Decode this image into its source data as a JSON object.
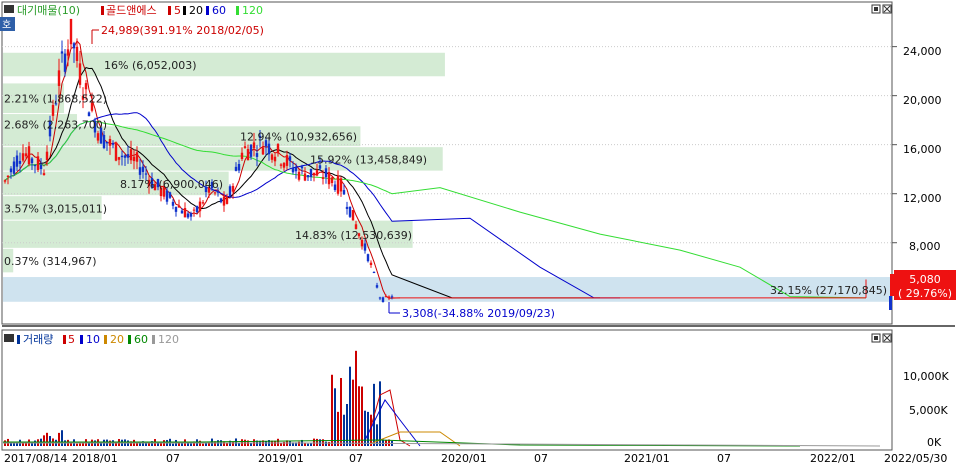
{
  "price_panel": {
    "legend": [
      "대기매물(10)",
      "골드앤에스",
      "5",
      "20",
      "60",
      "120"
    ],
    "legend_colors": [
      "#2a9d2a",
      "#cc0000",
      "#cc0000",
      "#000000",
      "#0000cc",
      "#33dd33"
    ],
    "y_ticks": [
      "24,000",
      "20,000",
      "16,000",
      "12,000",
      "8,000"
    ],
    "high_label": "24,989(391.91% 2018/02/05)",
    "low_label": "3,308(-34.88% 2019/09/23)",
    "current_price": "5,080",
    "current_change": "( 29.76%)",
    "left_tab": "호"
  },
  "volume_panel": {
    "legend": [
      "거래량",
      "5",
      "10",
      "20",
      "60",
      "120"
    ],
    "legend_colors": [
      "#003399",
      "#cc0000",
      "#0000cc",
      "#cc8800",
      "#008800",
      "#999999"
    ],
    "y_ticks": [
      "10,000K",
      "5,000K",
      "0K"
    ]
  },
  "x_axis": {
    "labels": [
      "2017/08/14",
      "2018/01",
      "07",
      "2019/01",
      "07",
      "2020/01",
      "07",
      "2021/01",
      "07",
      "2022/01",
      "2022/05/30"
    ]
  },
  "chart_data": {
    "type": "candlestick",
    "title": "골드앤에스",
    "x_range": [
      "2017/08/14",
      "2022/05/30"
    ],
    "ylim": [
      3000,
      26500
    ],
    "volume_ylim": [
      0,
      14500
    ],
    "volume_unit": "K",
    "high": {
      "date": "2018/02/05",
      "value": 24989,
      "change_pct": 391.91
    },
    "low": {
      "date": "2019/09/23",
      "value": 3308,
      "change_pct": -34.88
    },
    "last": {
      "date": "2022/05/30",
      "value": 5080,
      "change_pct": 29.76
    },
    "overhang_volume_profile": [
      {
        "label": "16% (6,052,003)",
        "percent": 16
      },
      {
        "label": "2.21% (1,868,522)",
        "percent": 2.21
      },
      {
        "label": "2.68% (2,263,700)",
        "percent": 2.68
      },
      {
        "label": "12.94% (10,932,656)",
        "percent": 12.94
      },
      {
        "label": "15.92% (13,458,849)",
        "percent": 15.92
      },
      {
        "label": "8.17% (6,900,046)",
        "percent": 8.17
      },
      {
        "label": "3.57% (3,015,011)",
        "percent": 3.57
      },
      {
        "label": "14.83% (12,530,639)",
        "percent": 14.83
      },
      {
        "label": "0.37% (314,967)",
        "percent": 0.37
      },
      {
        "label": "32.15% (27,170,845)",
        "percent": 32.15
      }
    ],
    "moving_averages": [
      "5",
      "20",
      "60",
      "120"
    ]
  }
}
